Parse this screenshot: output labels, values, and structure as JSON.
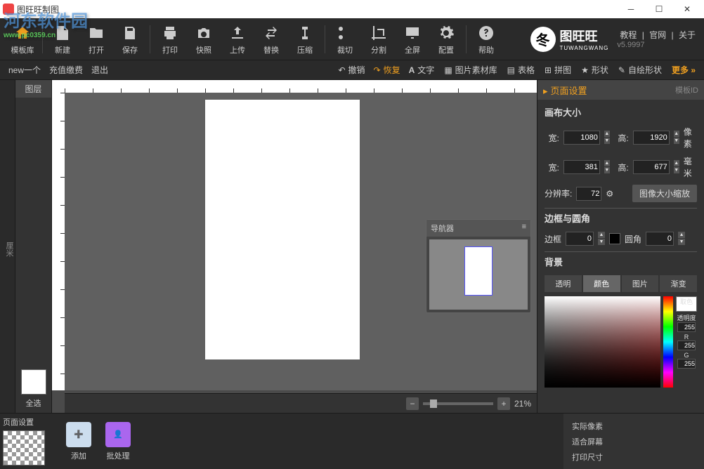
{
  "window": {
    "title": "图旺旺制图"
  },
  "watermark": {
    "main": "河东软件园",
    "url": "www.pc0359.cn"
  },
  "top_links": {
    "tutorial": "教程",
    "site": "官网",
    "about": "关于"
  },
  "logo": {
    "text": "图旺旺",
    "sub": "TUWANGWANG",
    "symbol": "冬"
  },
  "version": "v5.9997",
  "toolbar": {
    "template_lib": "模板库",
    "new": "新建",
    "open": "打开",
    "save": "保存",
    "print": "打印",
    "snapshot": "快照",
    "upload": "上传",
    "replace": "替换",
    "compress": "压缩",
    "crop": "裁切",
    "split": "分割",
    "fullscreen": "全屏",
    "config": "配置",
    "help": "帮助"
  },
  "subbar": {
    "new_one": "new一个",
    "recharge": "充值缴费",
    "exit": "退出",
    "undo": "撤销",
    "redo": "恢复",
    "text": "文字",
    "material": "图片素材库",
    "table": "表格",
    "puzzle": "拼图",
    "shape": "形状",
    "draw_shape": "自绘形状",
    "more": "更多"
  },
  "ruler_unit": "厘米",
  "layers": {
    "title": "图层",
    "select_all": "全选"
  },
  "navigator": {
    "title": "导航器"
  },
  "zoom": {
    "percent": "21%"
  },
  "right": {
    "header": "页面设置",
    "template_id": "模板ID",
    "canvas_size": "画布大小",
    "w_label": "宽:",
    "h_label": "高:",
    "px_w": "1080",
    "px_h": "1920",
    "px_unit": "像素",
    "mm_w": "381",
    "mm_h": "677",
    "mm_unit": "毫米",
    "dpi_label": "分辨率:",
    "dpi": "72",
    "scale_btn": "图像大小缩放",
    "border_title": "边框与圆角",
    "border_label": "边框",
    "border_val": "0",
    "radius_label": "圆角",
    "radius_val": "0",
    "bg_title": "背景",
    "bg_tabs": {
      "transparent": "透明",
      "color": "颜色",
      "image": "图片",
      "gradient": "渐变"
    },
    "pick_color": "取色",
    "opacity": "透明度",
    "ch": {
      "a": "255",
      "r": "255",
      "g": "255"
    }
  },
  "bottom": {
    "page_settings": "页面设置",
    "add": "添加",
    "batch": "批处理",
    "actual_px": "实际像素",
    "fit_screen": "适合屏幕",
    "print_size": "打印尺寸"
  }
}
